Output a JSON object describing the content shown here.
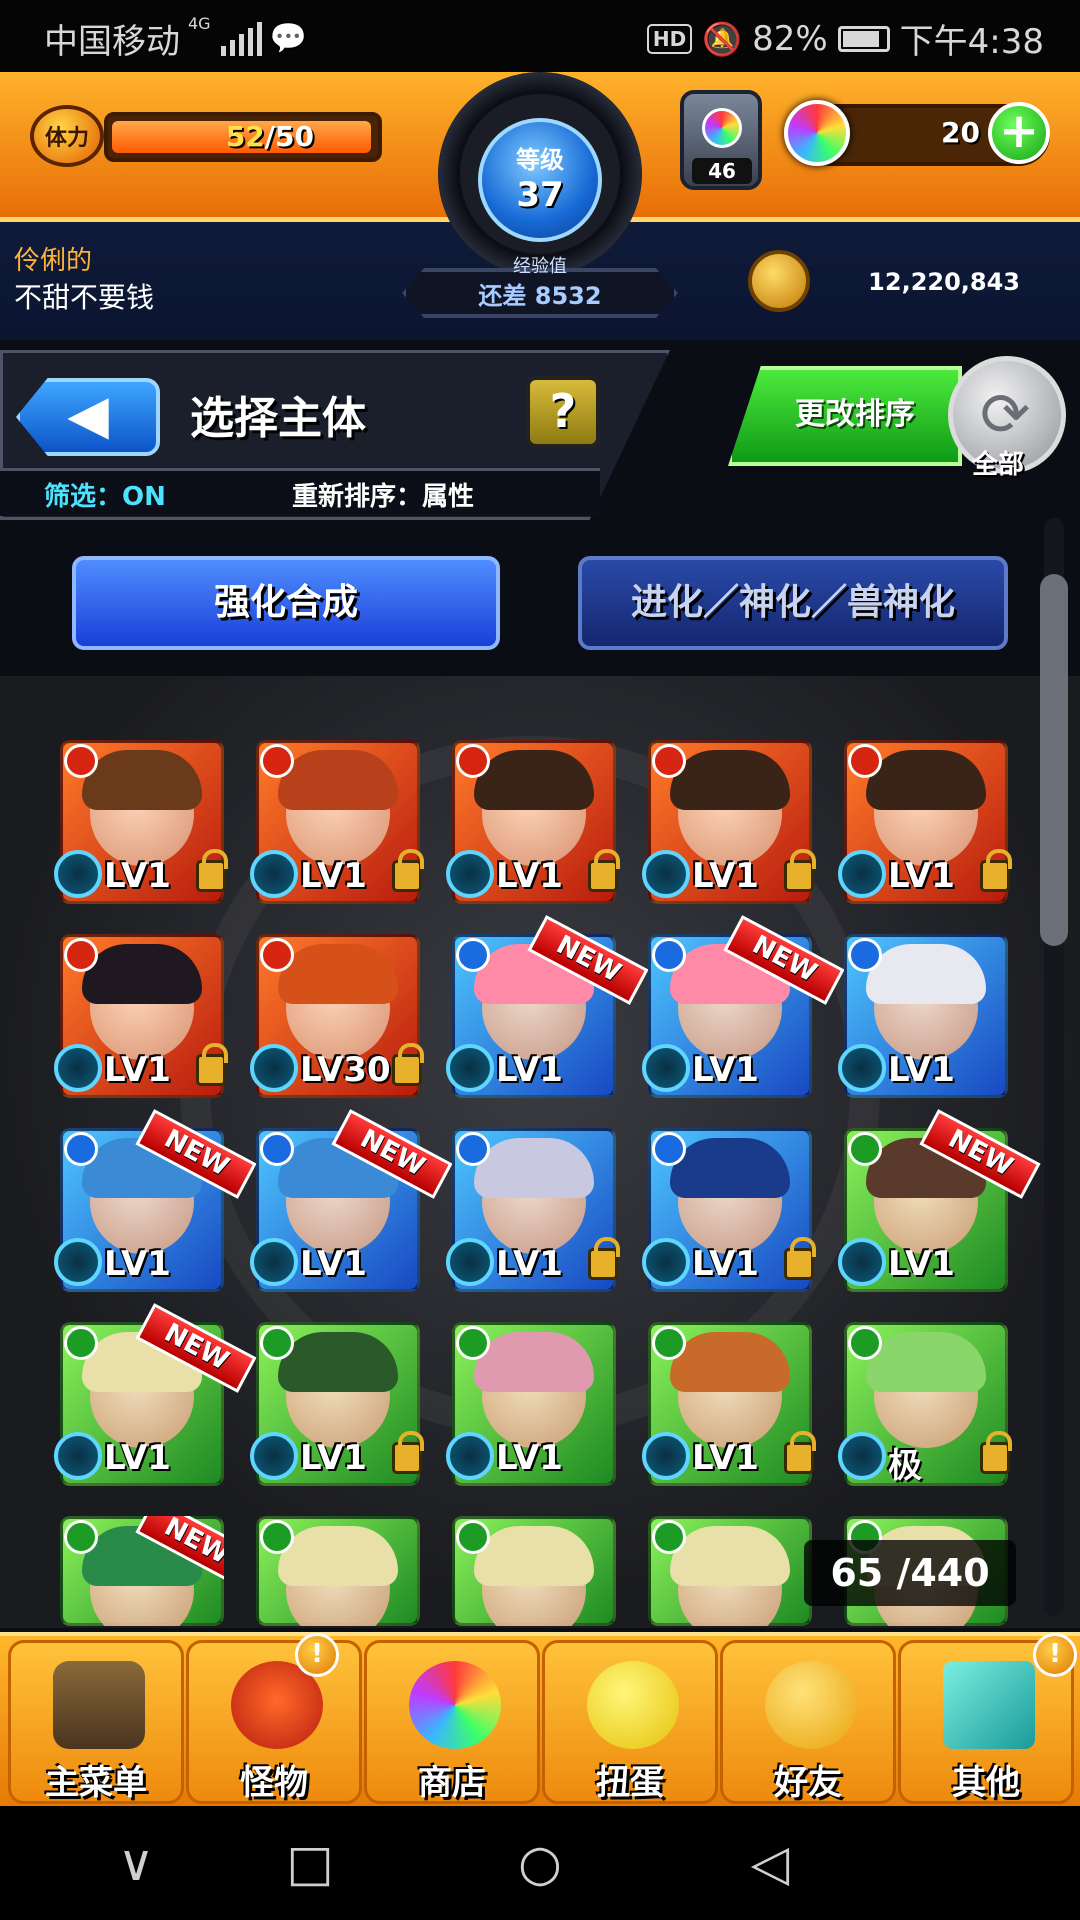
{
  "status": {
    "carrier": "中国移动",
    "network": "4G",
    "battery": "82%",
    "time": "下午4:38"
  },
  "hud": {
    "stamina_label": "体力",
    "stamina_current": "52",
    "stamina_max": "/50",
    "level_label": "等级",
    "level": "37",
    "exp_label": "经验值",
    "exp_remaining": "还差 8532",
    "gem_count": "46",
    "orb_count": "20",
    "player_title": "伶俐的",
    "player_name": "不甜不要钱",
    "gold": "12,220,843"
  },
  "header": {
    "title": "选择主体",
    "help": "?",
    "filter": "筛选：ON",
    "sort": "重新排序：属性",
    "change_sort": "更改排序",
    "all": "全部"
  },
  "tabs": {
    "enhance": "强化合成",
    "evolve": "进化／神化／兽神化"
  },
  "monsters": [
    {
      "attr": "fire",
      "lv": "LV1",
      "locked": true,
      "new": false
    },
    {
      "attr": "fire",
      "lv": "LV1",
      "locked": true,
      "new": false
    },
    {
      "attr": "fire",
      "lv": "LV1",
      "locked": true,
      "new": false
    },
    {
      "attr": "fire",
      "lv": "LV1",
      "locked": true,
      "new": false
    },
    {
      "attr": "fire",
      "lv": "LV1",
      "locked": true,
      "new": false
    },
    {
      "attr": "fire",
      "lv": "LV1",
      "locked": true,
      "new": false
    },
    {
      "attr": "fire",
      "lv": "LV30",
      "locked": true,
      "new": false
    },
    {
      "attr": "water",
      "lv": "LV1",
      "locked": false,
      "new": true
    },
    {
      "attr": "water",
      "lv": "LV1",
      "locked": false,
      "new": true
    },
    {
      "attr": "water",
      "lv": "LV1",
      "locked": false,
      "new": false
    },
    {
      "attr": "water",
      "lv": "LV1",
      "locked": false,
      "new": true
    },
    {
      "attr": "water",
      "lv": "LV1",
      "locked": false,
      "new": true
    },
    {
      "attr": "water",
      "lv": "LV1",
      "locked": true,
      "new": false
    },
    {
      "attr": "water",
      "lv": "LV1",
      "locked": true,
      "new": false
    },
    {
      "attr": "wood",
      "lv": "LV1",
      "locked": false,
      "new": true
    },
    {
      "attr": "wood",
      "lv": "LV1",
      "locked": false,
      "new": true
    },
    {
      "attr": "wood",
      "lv": "LV1",
      "locked": true,
      "new": false
    },
    {
      "attr": "wood",
      "lv": "LV1",
      "locked": false,
      "new": false
    },
    {
      "attr": "wood",
      "lv": "LV1",
      "locked": true,
      "new": false
    },
    {
      "attr": "wood",
      "lv": "极",
      "locked": true,
      "new": false
    },
    {
      "attr": "wood",
      "lv": "",
      "locked": false,
      "new": true
    },
    {
      "attr": "wood",
      "lv": "",
      "locked": false,
      "new": false
    },
    {
      "attr": "wood",
      "lv": "",
      "locked": false,
      "new": false
    },
    {
      "attr": "wood",
      "lv": "",
      "locked": false,
      "new": false
    },
    {
      "attr": "wood",
      "lv": "",
      "locked": false,
      "new": false
    }
  ],
  "new_tag": "NEW",
  "box_count": "65 /440",
  "nav": [
    {
      "label": "主菜单",
      "icon": "castle-gate-icon",
      "badge": ""
    },
    {
      "label": "怪物",
      "icon": "monster-icon",
      "badge": "!"
    },
    {
      "label": "商店",
      "icon": "rainbow-orb-icon",
      "badge": ""
    },
    {
      "label": "扭蛋",
      "icon": "egg-icon",
      "badge": ""
    },
    {
      "label": "好友",
      "icon": "balloons-icon",
      "badge": ""
    },
    {
      "label": "其他",
      "icon": "question-block-icon",
      "badge": "!"
    }
  ],
  "sysnav": {
    "back": "◁",
    "home": "○",
    "recent": "□",
    "down": "∨"
  }
}
